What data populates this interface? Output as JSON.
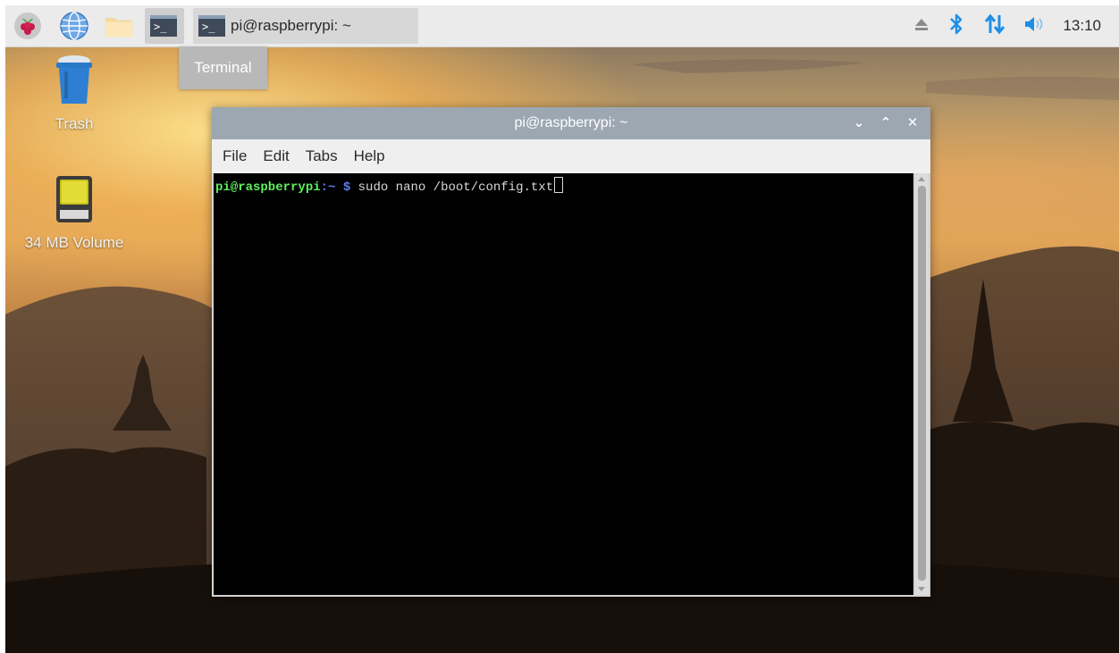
{
  "panel": {
    "launchers": [
      {
        "name": "raspberry-menu-icon"
      },
      {
        "name": "globe-icon"
      },
      {
        "name": "folder-icon"
      },
      {
        "name": "terminal-icon"
      }
    ],
    "task": {
      "label": "pi@raspberrypi: ~",
      "icon": "terminal-icon"
    },
    "tray": {
      "icons": [
        "eject-icon",
        "bluetooth-icon",
        "network-icon",
        "volume-icon"
      ],
      "clock": "13:10",
      "accent": "#1c8fe8"
    }
  },
  "tooltip": {
    "text": "Terminal"
  },
  "desktop": {
    "icons": [
      {
        "label": "Trash",
        "icon": "trash-icon"
      },
      {
        "label": "34 MB Volume",
        "icon": "drive-icon"
      }
    ]
  },
  "terminal": {
    "title": "pi@raspberrypi: ~",
    "controls": [
      "minimize",
      "maximize",
      "close"
    ],
    "control_glyphs": {
      "minimize": "⌄",
      "maximize": "⌃",
      "close": "✕"
    },
    "menu": [
      "File",
      "Edit",
      "Tabs",
      "Help"
    ],
    "prompt": {
      "user_host": "pi@raspberrypi",
      "separator": ":",
      "path": "~",
      "symbol": "$",
      "command": "sudo nano /boot/config.txt"
    },
    "colors": {
      "user": "#5ef05e",
      "path": "#5e7ff0",
      "background": "#000000"
    }
  }
}
